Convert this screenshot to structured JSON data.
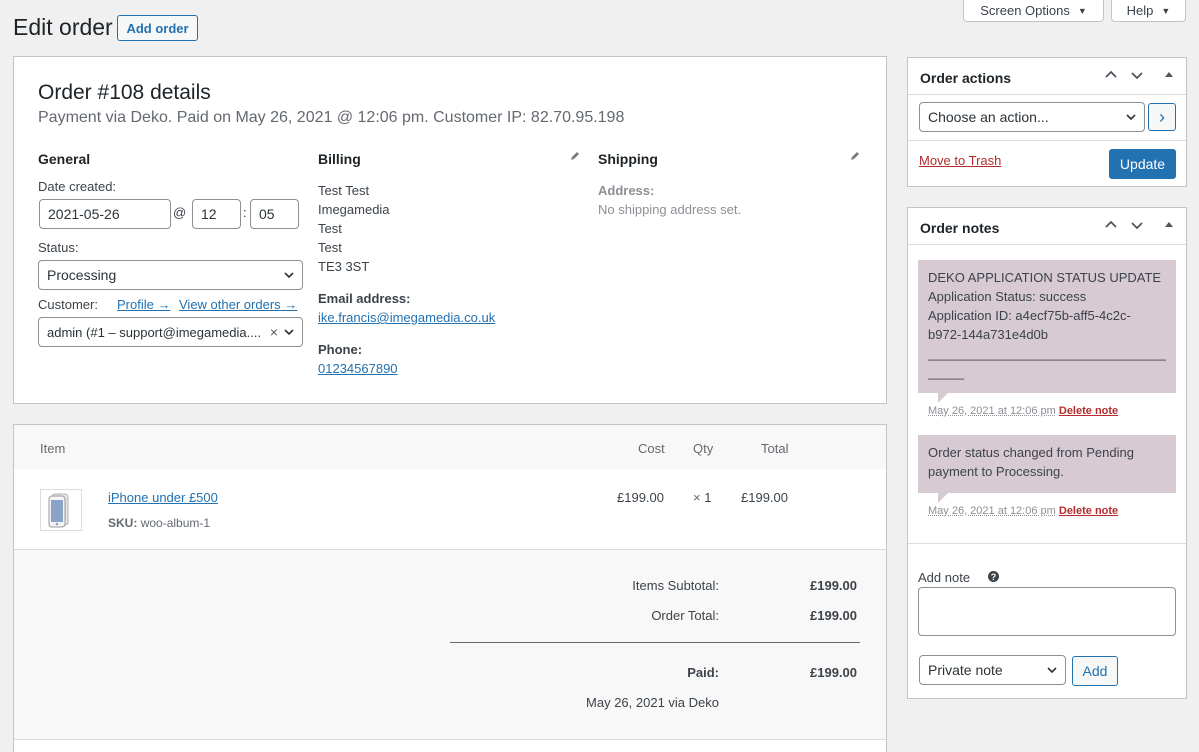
{
  "header": {
    "title": "Edit order",
    "add_order_label": "Add order",
    "screen_options_label": "Screen Options",
    "help_label": "Help"
  },
  "order": {
    "heading": "Order #108 details",
    "subheading": "Payment via Deko. Paid on May 26, 2021 @ 12:06 pm. Customer IP: 82.70.95.198",
    "general": {
      "title": "General",
      "date_label": "Date created:",
      "date_value": "2021-05-26",
      "at_sep": "@",
      "hour": "12",
      "time_sep": ":",
      "minute": "05",
      "status_label": "Status:",
      "status_value": "Processing",
      "customer_label": "Customer:",
      "profile_link": "Profile →",
      "view_orders_link": "View other orders →",
      "customer_value": "admin (#1 – support@imegamedia....",
      "clear_symbol": "×"
    },
    "billing": {
      "title": "Billing",
      "address_lines": [
        "Test Test",
        "Imegamedia",
        "Test",
        "Test",
        "TE3 3ST"
      ],
      "email_label": "Email address:",
      "email": "ike.francis@imegamedia.co.uk",
      "phone_label": "Phone:",
      "phone": "01234567890"
    },
    "shipping": {
      "title": "Shipping",
      "address_label": "Address:",
      "address_value": "No shipping address set."
    }
  },
  "items": {
    "columns": {
      "item": "Item",
      "cost": "Cost",
      "qty": "Qty",
      "total": "Total"
    },
    "rows": [
      {
        "name": "iPhone under £500",
        "sku_label": "SKU:",
        "sku": "woo-album-1",
        "cost": "£199.00",
        "qty_prefix": "×",
        "qty": "1",
        "total": "£199.00"
      }
    ],
    "totals": {
      "subtotal_label": "Items Subtotal:",
      "subtotal_value": "£199.00",
      "order_total_label": "Order Total:",
      "order_total_value": "£199.00",
      "paid_label": "Paid:",
      "paid_value": "£199.00",
      "paid_note": "May 26, 2021 via Deko"
    }
  },
  "order_actions": {
    "title": "Order actions",
    "select_value": "Choose an action...",
    "go_label": "›",
    "trash_label": "Move to Trash",
    "update_label": "Update"
  },
  "order_notes": {
    "title": "Order notes",
    "notes": [
      {
        "text_lines": [
          "DEKO APPLICATION STATUS UPDATE",
          "Application Status: success",
          "Application ID: a4ecf75b-aff5-4c2c-",
          "b972-144a731e4d0b",
          "___________________________________",
          "_____"
        ],
        "date": "May 26, 2021 at 12:06 pm",
        "delete_label": "Delete note"
      },
      {
        "text_lines": [
          "Order status changed from Pending",
          "payment to Processing."
        ],
        "date": "May 26, 2021 at 12:06 pm",
        "delete_label": "Delete note"
      }
    ],
    "add_note_label": "Add note",
    "help_symbol": "?",
    "note_type": "Private note",
    "add_button": "Add"
  }
}
